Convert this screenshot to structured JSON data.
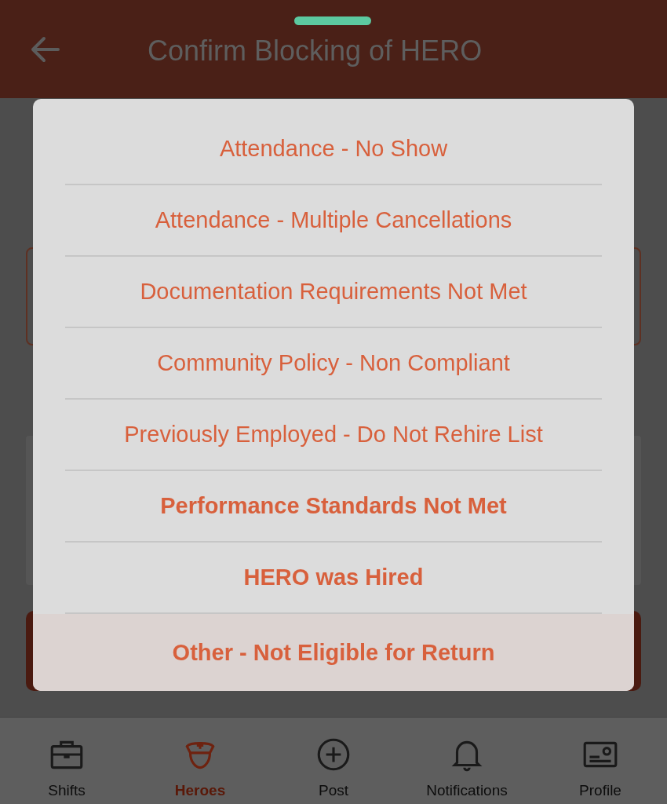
{
  "header": {
    "title": "Confirm Blocking of HERO"
  },
  "reason_options": [
    {
      "label": "Attendance - No Show",
      "selected": false,
      "pressed": false
    },
    {
      "label": "Attendance - Multiple Cancellations",
      "selected": false,
      "pressed": false
    },
    {
      "label": "Documentation Requirements Not Met",
      "selected": false,
      "pressed": false
    },
    {
      "label": "Community Policy - Non Compliant",
      "selected": false,
      "pressed": false
    },
    {
      "label": "Previously Employed - Do Not Rehire List",
      "selected": false,
      "pressed": false
    },
    {
      "label": "Performance Standards Not Met",
      "selected": true,
      "pressed": false
    },
    {
      "label": "HERO was Hired",
      "selected": true,
      "pressed": false
    },
    {
      "label": "Other - Not Eligible for Return",
      "selected": true,
      "pressed": true
    }
  ],
  "bottom_nav": [
    {
      "label": "Shifts",
      "selected": false
    },
    {
      "label": "Heroes",
      "selected": true
    },
    {
      "label": "Post",
      "selected": false
    },
    {
      "label": "Notifications",
      "selected": false
    },
    {
      "label": "Profile",
      "selected": false
    }
  ]
}
